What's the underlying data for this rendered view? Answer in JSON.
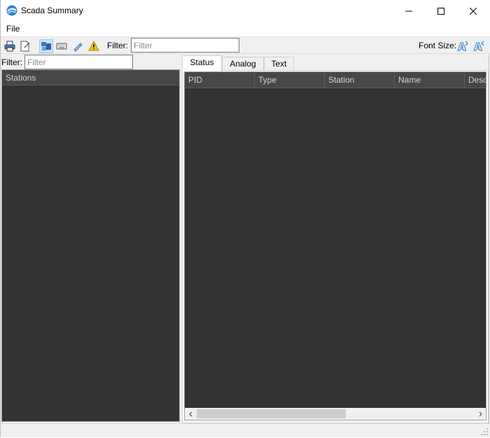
{
  "window": {
    "title": "Scada Summary",
    "controls": [
      "minimize",
      "maximize",
      "close"
    ]
  },
  "menu": {
    "items": [
      "File"
    ]
  },
  "toolbar": {
    "buttons": [
      {
        "icon": "printer-icon"
      },
      {
        "icon": "export-icon"
      },
      {
        "icon": "tile-view-icon",
        "active": true
      },
      {
        "icon": "keyboard-icon"
      },
      {
        "icon": "tag-icon"
      },
      {
        "icon": "warning-icon"
      }
    ],
    "filter_label": "Filter:",
    "filter_placeholder": "Filter",
    "font_size_label": "Font Size:",
    "font_buttons": [
      {
        "icon": "font-increase-icon"
      },
      {
        "icon": "font-decrease-icon"
      }
    ]
  },
  "left_panel": {
    "filter_label": "Filter:",
    "filter_placeholder": "Filter",
    "grid_header": "Stations"
  },
  "tabs": {
    "items": [
      "Status",
      "Analog",
      "Text"
    ],
    "selected": "Status"
  },
  "status_grid": {
    "columns": [
      "PID",
      "Type",
      "Station",
      "Name",
      "Desc"
    ]
  },
  "colors": {
    "grid_background": "#333333",
    "grid_header": "#474747",
    "accent": "#1e73be"
  }
}
